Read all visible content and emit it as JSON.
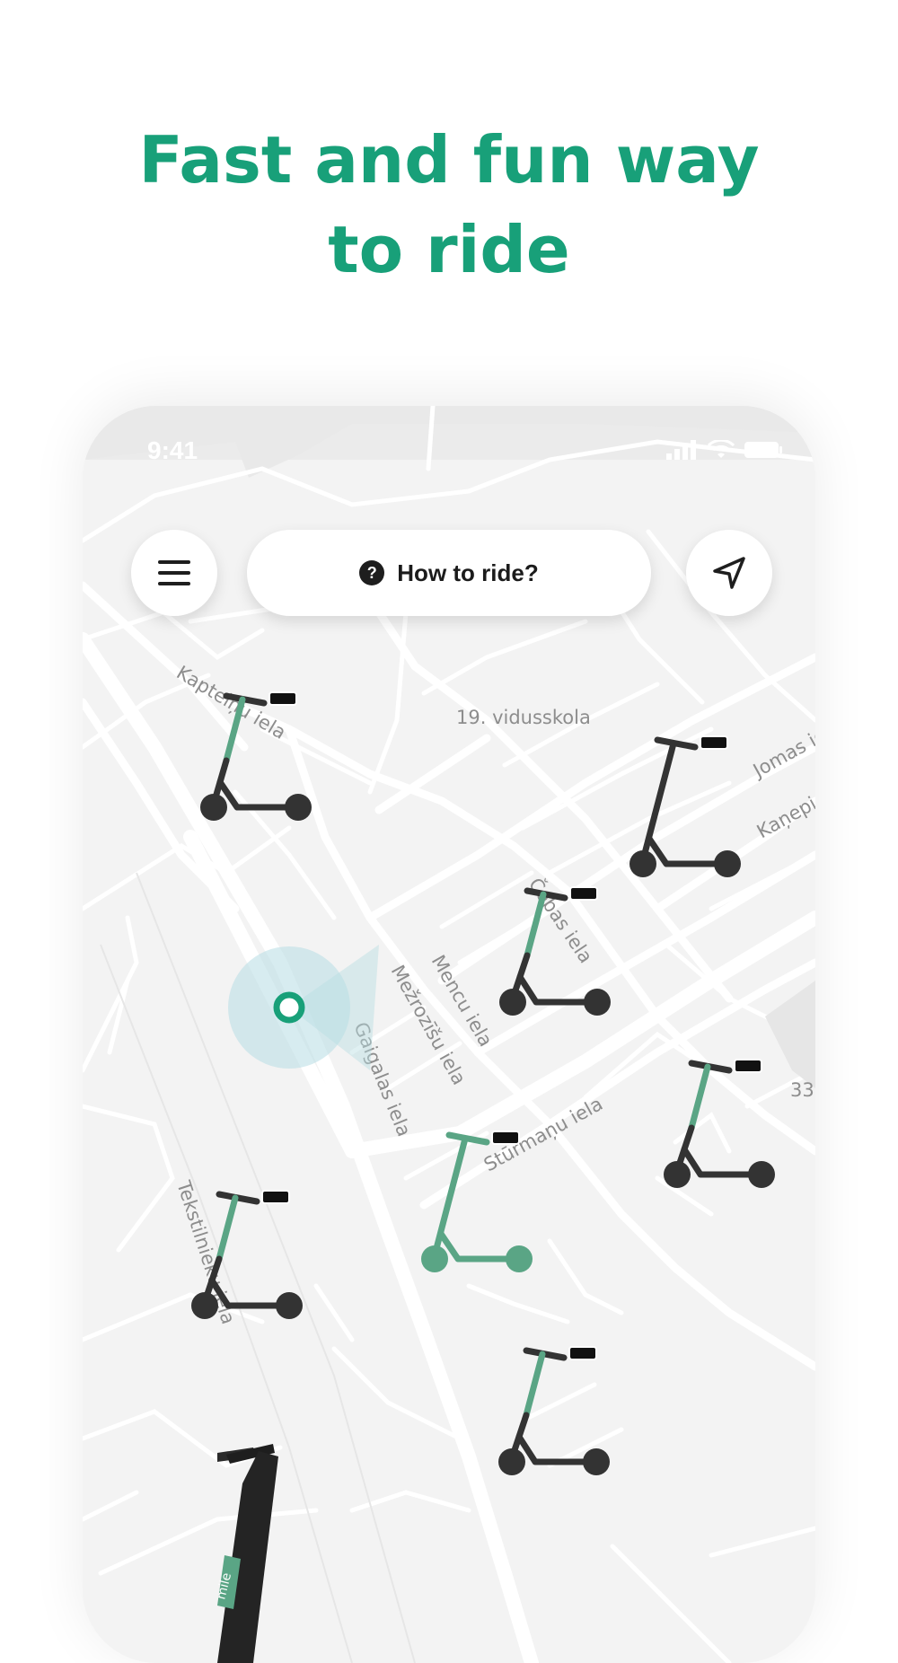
{
  "headline": {
    "line1": "Fast and fun way",
    "line2": "to ride"
  },
  "status_bar": {
    "time": "9:41",
    "icons": [
      "signal-icon",
      "wifi-icon",
      "battery-icon"
    ]
  },
  "toolbar": {
    "menu_icon": "menu-icon",
    "help_icon_glyph": "?",
    "help_label": "How to ride?",
    "locate_icon": "navigation-arrow-icon"
  },
  "map": {
    "streets": {
      "kapteinu": "Kapteiņu iela",
      "school": "19. vidusskola",
      "jomas": "Jomas iela",
      "kanepi": "Kaņepi",
      "lobas": "Čobas iela",
      "mezrozisu": "Mežrozīšu iela",
      "mencu": "Mencu iela",
      "gaigalas": "Gaigalas iela",
      "sturmanu": "Stūrmaņu iela",
      "tekstilnieku": "Tekstilnieku iela",
      "num33": "33."
    },
    "scooter_brand": "mile"
  },
  "colors": {
    "accent": "#18a079",
    "scooter_dark": "#333333",
    "scooter_green": "#5aa585",
    "map_bg": "#f3f3f3"
  }
}
